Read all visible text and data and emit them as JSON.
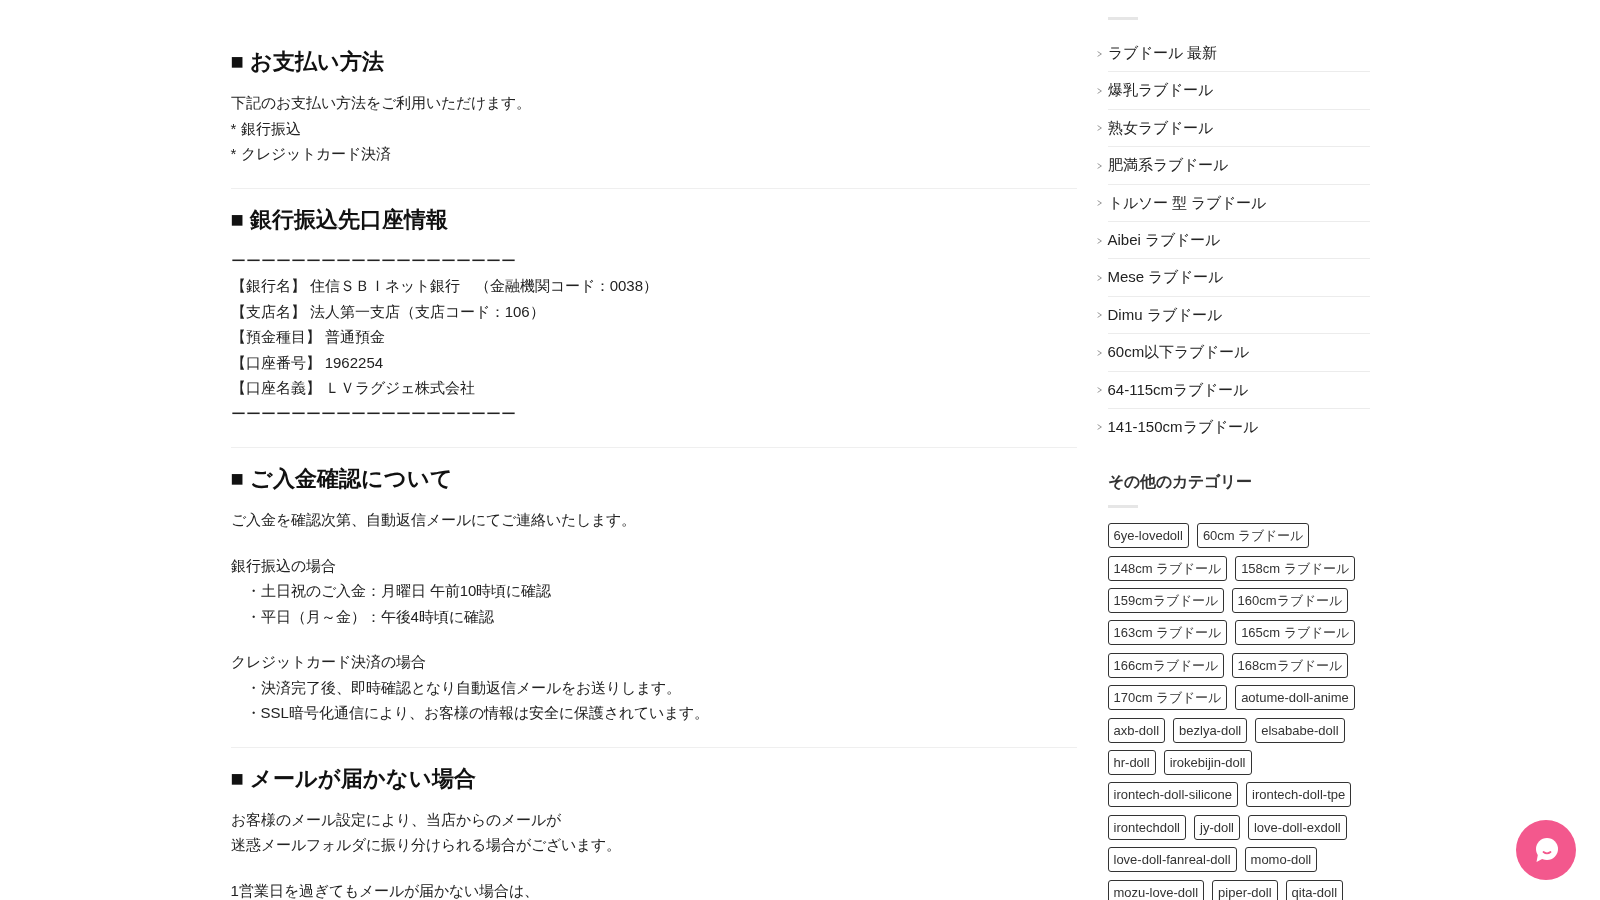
{
  "sections": [
    {
      "title": "■ お支払い方法",
      "paragraphs": [
        [
          {
            "kind": "line",
            "text": "下記のお支払い方法をご利用いただけます。"
          },
          {
            "kind": "line",
            "text": "* 銀行振込"
          },
          {
            "kind": "line",
            "text": "* クレジットカード決済"
          }
        ]
      ]
    },
    {
      "title": "■ 銀行振込先口座情報",
      "paragraphs": [
        [
          {
            "kind": "dashes",
            "text": "ーーーーーーーーーーーーーーーーーーー"
          },
          {
            "kind": "line",
            "text": "【銀行名】 住信ＳＢＩネット銀行　（金融機関コード：0038）"
          },
          {
            "kind": "line",
            "text": "【支店名】 法人第一支店（支店コード：106）"
          },
          {
            "kind": "line",
            "text": "【預金種目】 普通預金"
          },
          {
            "kind": "line",
            "text": "【口座番号】 1962254"
          },
          {
            "kind": "line",
            "text": "【口座名義】 ＬＶラグジェ株式会社"
          },
          {
            "kind": "dashes",
            "text": "ーーーーーーーーーーーーーーーーーーー"
          }
        ]
      ]
    },
    {
      "title": "■ ご入金確認について",
      "paragraphs": [
        [
          {
            "kind": "line",
            "text": "ご入金を確認次第、自動返信メールにてご連絡いたします。"
          }
        ],
        [
          {
            "kind": "line",
            "text": "銀行振込の場合"
          },
          {
            "kind": "bullet",
            "text": "・土日祝のご入金：月曜日 午前10時頃に確認"
          },
          {
            "kind": "bullet",
            "text": "・平日（月～金）：午後4時頃に確認"
          }
        ],
        [
          {
            "kind": "line",
            "text": "クレジットカード決済の場合"
          },
          {
            "kind": "bullet",
            "text": "・決済完了後、即時確認となり自動返信メールをお送りします。"
          },
          {
            "kind": "bullet",
            "text": "・SSL暗号化通信により、お客様の情報は安全に保護されています。"
          }
        ]
      ]
    },
    {
      "title": "■ メールが届かない場合",
      "paragraphs": [
        [
          {
            "kind": "line",
            "text": "お客様のメール設定により、当店からのメールが"
          },
          {
            "kind": "line",
            "text": "迷惑メールフォルダに振り分けられる場合がございます。"
          }
        ],
        [
          {
            "kind": "line",
            "text": "1営業日を過ぎてもメールが届かない場合は、"
          }
        ]
      ]
    }
  ],
  "sidebar": [
    {
      "kind": "list",
      "items": [
        "ラブドール 最新",
        "爆乳ラブドール",
        "熟女ラブドール",
        "肥満系ラブドール",
        "トルソー 型 ラブドール",
        "Aibei ラブドール",
        "Mese ラブドール",
        "Dimu ラブドール",
        "60cm以下ラブドール",
        "64-115cmラブドール",
        "141-150cmラブドール"
      ]
    },
    {
      "kind": "tags",
      "title": "その他のカテゴリー",
      "items": [
        "6ye-lovedoll",
        "60cm ラブドール",
        "148cm ラブドール",
        "158cm ラブドール",
        "159cmラブドール",
        "160cmラブドール",
        "163cm ラブドール",
        "165cm ラブドール",
        "166cmラブドール",
        "168cmラブドール",
        "170cm ラブドール",
        "aotume-doll-anime",
        "axb-doll",
        "bezlya-doll",
        "elsababe-doll",
        "hr-doll",
        "irokebijin-doll",
        "irontech-doll-silicone",
        "irontech-doll-tpe",
        "irontechdoll",
        "jy-doll",
        "love-doll-exdoll",
        "love-doll-fanreal-doll",
        "momo-doll",
        "mozu-love-doll",
        "piper-doll",
        "qita-doll"
      ]
    }
  ]
}
